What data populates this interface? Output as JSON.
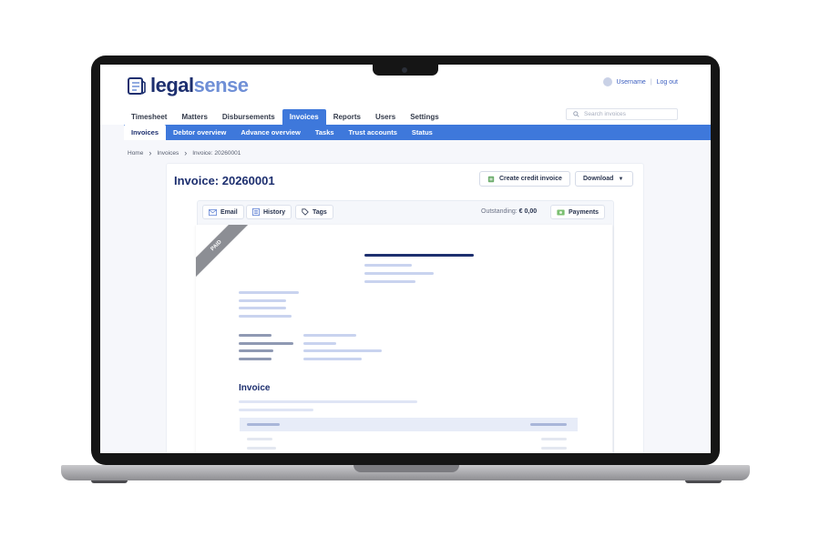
{
  "brand": {
    "logo_part1": "legal",
    "logo_part2": "sense"
  },
  "user": {
    "username": "Username",
    "separator": "|",
    "logout": "Log out"
  },
  "nav": {
    "items": [
      "Timesheet",
      "Matters",
      "Disbursements",
      "Invoices",
      "Reports",
      "Users",
      "Settings"
    ],
    "active": "Invoices"
  },
  "search": {
    "placeholder": "Search invoices"
  },
  "subnav": {
    "items": [
      "Invoices",
      "Debtor overview",
      "Advance overview",
      "Tasks",
      "Trust accounts",
      "Status"
    ],
    "active": "Invoices"
  },
  "breadcrumb": [
    "Home",
    "Invoices",
    "Invoice: 20260001"
  ],
  "page": {
    "title": "Invoice: 20260001",
    "credit_button": "Create credit invoice",
    "download_button": "Download"
  },
  "toolbar": {
    "email": "Email",
    "history": "History",
    "tags": "Tags",
    "outstanding_label": "Outstanding:",
    "outstanding_value": "€ 0,00",
    "payments": "Payments"
  },
  "document": {
    "status_ribbon": "PAID",
    "heading": "Invoice"
  },
  "colors": {
    "accent": "#3e78db",
    "brand_dark": "#1d2f6f",
    "brand_light": "#6f8fd6",
    "ribbon": "#8c8e94"
  }
}
